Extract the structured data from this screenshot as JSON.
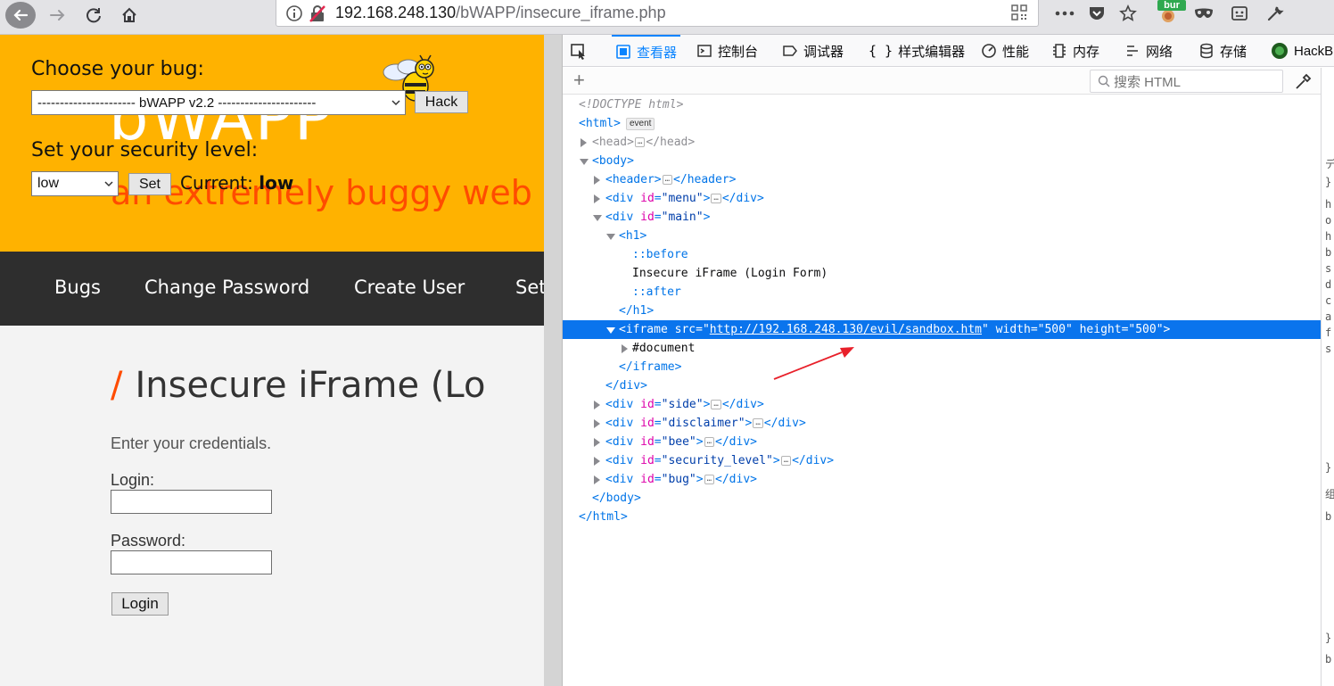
{
  "browser": {
    "url_host": "192.168.248.130",
    "url_path": "/bWAPP/insecure_iframe.php",
    "ext_badge": "bur"
  },
  "bwapp": {
    "choose_label": "Choose your bug:",
    "bug_select_value": "---------------------- bWAPP v2.2 ----------------------",
    "hack_label": "Hack",
    "logo_text": "bWAPP",
    "tagline": "an extremely buggy web a",
    "security_label": "Set your security level:",
    "security_value": "low",
    "set_label": "Set",
    "current_prefix": "Current:",
    "current_value": "low",
    "menu": [
      "Bugs",
      "Change Password",
      "Create User",
      "Set"
    ],
    "title": "Insecure iFrame (Lo",
    "title_slash": "/",
    "intro": "Enter your credentials.",
    "login_label": "Login:",
    "password_label": "Password:",
    "login_button": "Login"
  },
  "devtools": {
    "tabs": [
      "查看器",
      "控制台",
      "调试器",
      "样式编辑器",
      "性能",
      "内存",
      "网络",
      "存储",
      "HackB"
    ],
    "search_placeholder": "搜索 HTML",
    "add_node": "+",
    "event_badge": "event",
    "iframe_src": "http://192.168.248.130/evil/sandbox.htm",
    "iframe_width": "500",
    "iframe_height": "500",
    "h1_text": "Insecure iFrame (Login Form)",
    "side_chars": [
      "デ",
      "}",
      "h",
      "o",
      "h",
      "b",
      "s",
      "d",
      "c",
      "a",
      "f",
      "s",
      "}",
      "组",
      "b",
      "}",
      "b",
      "}"
    ]
  },
  "colors": {
    "header_yellow": "#ffb200",
    "tagline_orange": "#ff4c00",
    "selection_blue": "#0a74ed",
    "accent_blue": "#0a84ff",
    "annotation_red": "#e8202a"
  }
}
